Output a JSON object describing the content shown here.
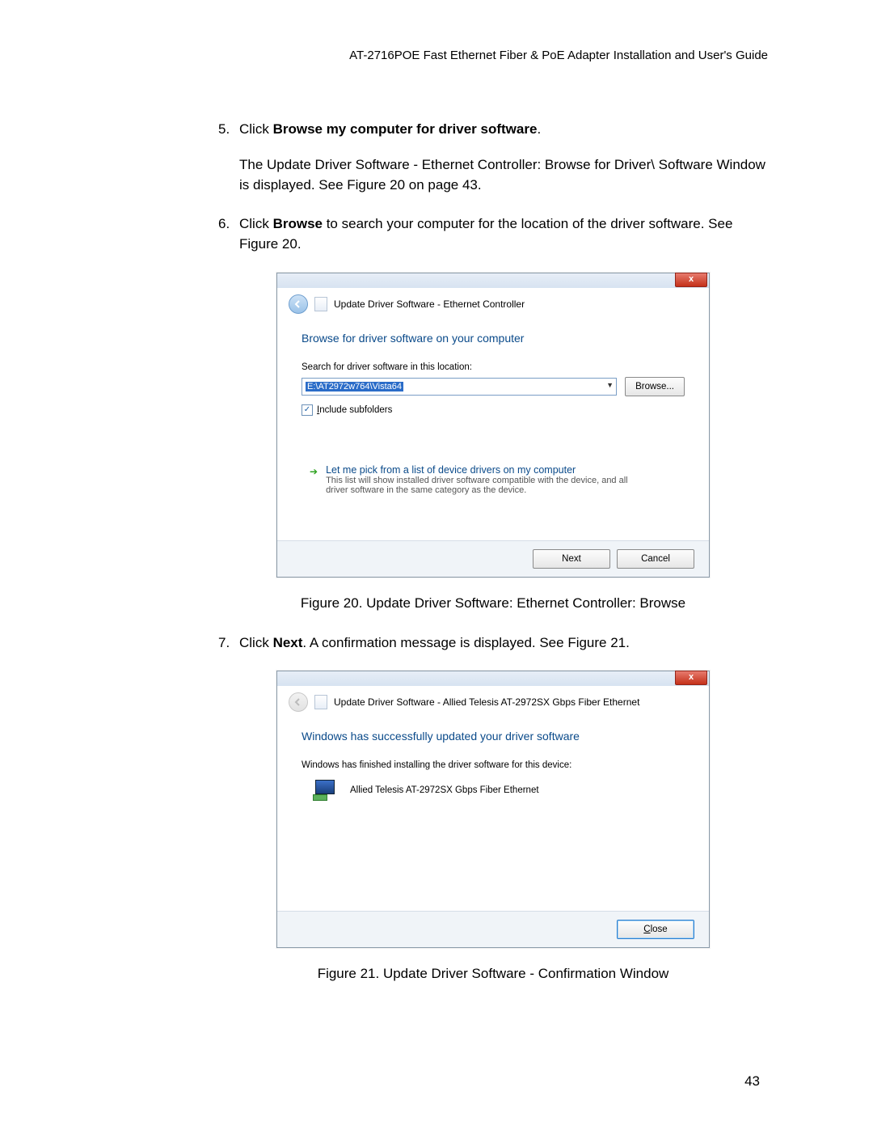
{
  "header": "AT-2716POE Fast Ethernet Fiber & PoE Adapter Installation and User's Guide",
  "step5": {
    "num": "5.",
    "lead": "Click ",
    "bold": "Browse my computer for driver software",
    "trail": ".",
    "p2": "The Update Driver Software - Ethernet Controller: Browse for Driver\\ Software Window is displayed. See Figure 20 on page 43."
  },
  "step6": {
    "num": "6.",
    "lead": "Click ",
    "bold": "Browse",
    "trail": " to search your computer for the location of the driver software. See Figure 20."
  },
  "fig20": {
    "close": "x",
    "nav_title": "Update Driver Software - Ethernet Controller",
    "heading": "Browse for driver software on your computer",
    "search_label": "Search for driver software in this location:",
    "path": "E:\\AT2972w764\\Vista64",
    "browse_btn": "Browse...",
    "include_sub": "Include subfolders",
    "pick_title": "Let me pick from a list of device drivers on my computer",
    "pick_desc": "This list will show installed driver software compatible with the device, and all driver software in the same category as the device.",
    "next_btn": "Next",
    "cancel_btn": "Cancel",
    "caption": "Figure 20. Update Driver Software: Ethernet Controller: Browse"
  },
  "step7": {
    "num": "7.",
    "lead": "Click ",
    "bold": "Next",
    "trail": ". A confirmation message is displayed. See Figure 21."
  },
  "fig21": {
    "close": "x",
    "nav_title": "Update Driver Software - Allied Telesis AT-2972SX Gbps Fiber Ethernet",
    "heading": "Windows has successfully updated your driver software",
    "finish_msg": "Windows has finished installing the driver software for this device:",
    "device_name": "Allied Telesis AT-2972SX Gbps Fiber Ethernet",
    "close_btn": "Close",
    "caption": "Figure 21. Update Driver Software - Confirmation Window"
  },
  "page_num": "43"
}
